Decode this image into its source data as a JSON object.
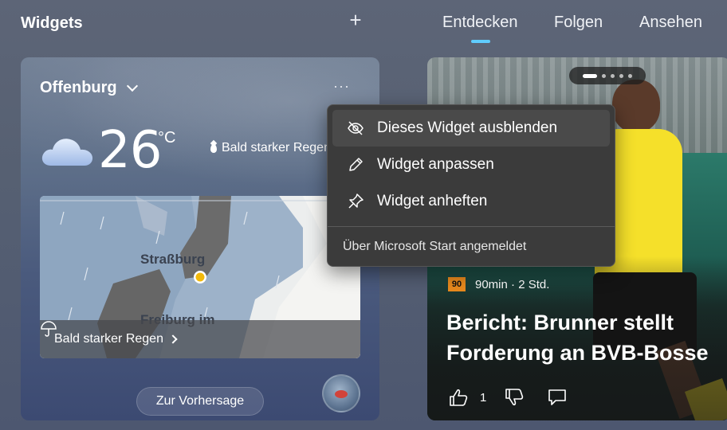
{
  "app": {
    "title": "Widgets",
    "add_symbol": "+"
  },
  "tabs": [
    {
      "label": "Entdecken",
      "active": true
    },
    {
      "label": "Folgen",
      "active": false
    },
    {
      "label": "Ansehen",
      "active": false
    }
  ],
  "weather": {
    "location": "Offenburg",
    "more_symbol": "···",
    "temperature": "26",
    "unit": "°C",
    "rain_hint": "Bald starker Regen",
    "map": {
      "labels": [
        "Straßburg",
        "Freiburg im"
      ],
      "overlay_text": "Bald starker Regen"
    },
    "forecast_button": "Zur Vorhersage",
    "icon": "partly-cloudy-icon"
  },
  "news": {
    "source": "90min",
    "source_logo": "90",
    "age": "· 2 Std.",
    "headline": "Bericht: Brunner stellt Forderung an BVB-Bosse",
    "likes": "1",
    "pager": {
      "count": 5,
      "active": 0
    }
  },
  "context_menu": {
    "items": [
      {
        "label": "Dieses Widget ausblenden",
        "icon": "eye-off-icon"
      },
      {
        "label": "Widget anpassen",
        "icon": "pencil-icon"
      },
      {
        "label": "Widget anheften",
        "icon": "pin-icon"
      }
    ],
    "footer": "Über Microsoft Start angemeldet"
  },
  "colors": {
    "accent": "#60cdff",
    "menu_bg": "#3b3b3b",
    "jersey": "#f5e02a"
  }
}
